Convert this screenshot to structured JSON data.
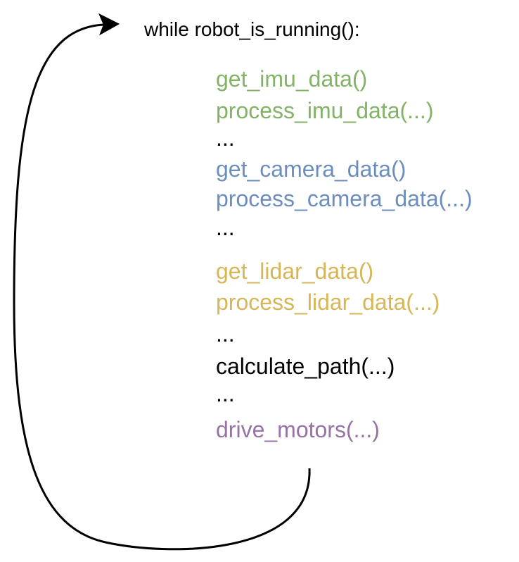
{
  "diagram": {
    "header": "while robot_is_running():",
    "lines": [
      {
        "text": "get_imu_data()",
        "color": "#82b366"
      },
      {
        "text": "process_imu_data(...)",
        "color": "#82b366"
      },
      {
        "text": "...",
        "color": "#000000"
      },
      {
        "text": "get_camera_data()",
        "color": "#6c8ebf"
      },
      {
        "text": "process_camera_data(...)",
        "color": "#6c8ebf"
      },
      {
        "text": "...",
        "color": "#000000"
      },
      {
        "text": "get_lidar_data()",
        "color": "#d6b656"
      },
      {
        "text": "process_lidar_data(...)",
        "color": "#d6b656"
      },
      {
        "text": "...",
        "color": "#000000"
      },
      {
        "text": "calculate_path(...)",
        "color": "#000000"
      },
      {
        "text": "...",
        "color": "#000000"
      },
      {
        "text": "drive_motors(...)",
        "color": "#9673a6"
      }
    ]
  }
}
